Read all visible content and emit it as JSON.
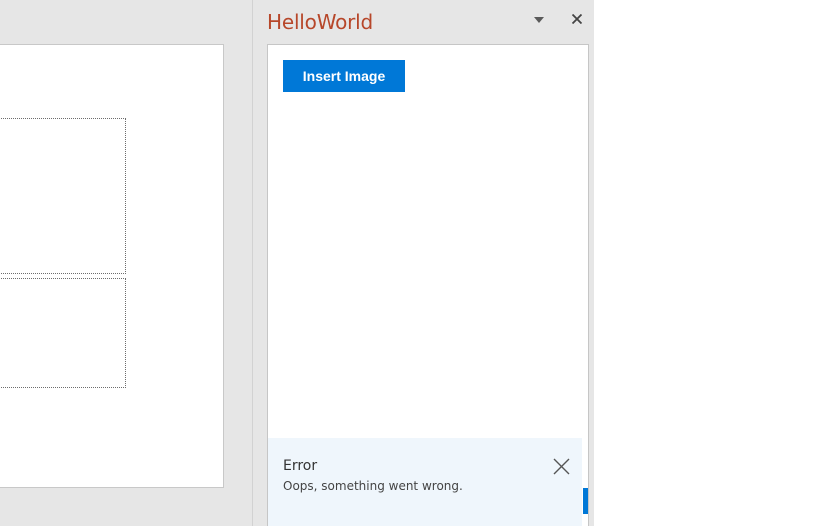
{
  "taskpane": {
    "title": "HelloWorld",
    "title_color": "#b7472a",
    "menu_icon": "caret-down-icon",
    "close_icon": "close-icon"
  },
  "content": {
    "insert_button_label": "Insert Image",
    "button_color": "#0078d7"
  },
  "notification": {
    "title": "Error",
    "message": "Oops, something went wrong.",
    "close_icon": "close-icon",
    "background": "#eff6fc"
  }
}
